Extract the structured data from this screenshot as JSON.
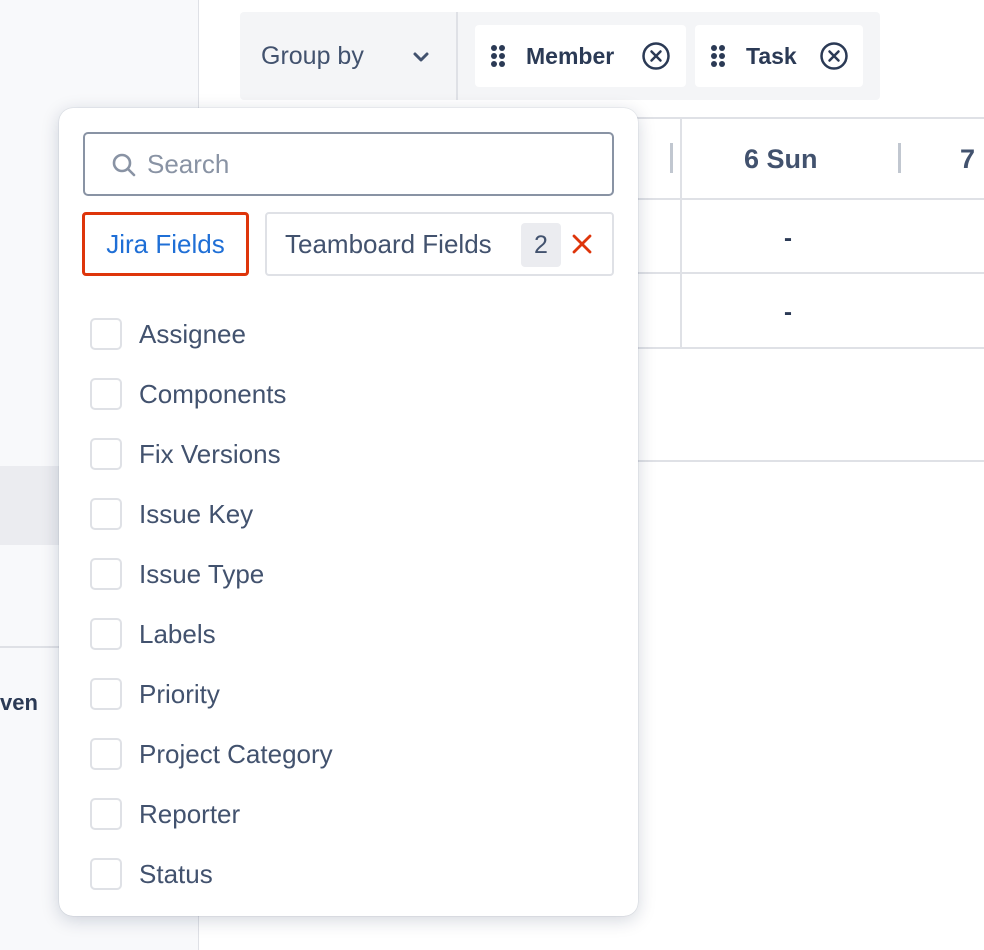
{
  "left_panel": {
    "partial_text": "ven"
  },
  "toolbar": {
    "group_by_label": "Group by",
    "chips": [
      {
        "label": "Member"
      },
      {
        "label": "Task"
      }
    ]
  },
  "calendar": {
    "days": [
      "6 Sun",
      "7"
    ],
    "cells": [
      "-",
      "-"
    ]
  },
  "dropdown": {
    "search": {
      "placeholder": "Search",
      "value": ""
    },
    "tabs": {
      "jira": {
        "label": "Jira Fields"
      },
      "teamboard": {
        "label": "Teamboard Fields",
        "count": "2"
      }
    },
    "fields": [
      {
        "label": "Assignee",
        "checked": false
      },
      {
        "label": "Components",
        "checked": false
      },
      {
        "label": "Fix Versions",
        "checked": false
      },
      {
        "label": "Issue Key",
        "checked": false
      },
      {
        "label": "Issue Type",
        "checked": false
      },
      {
        "label": "Labels",
        "checked": false
      },
      {
        "label": "Priority",
        "checked": false
      },
      {
        "label": "Project Category",
        "checked": false
      },
      {
        "label": "Reporter",
        "checked": false
      },
      {
        "label": "Status",
        "checked": false
      }
    ]
  },
  "colors": {
    "active_tab_border": "#de350b",
    "active_tab_text": "#1f6fd6",
    "clear_icon": "#de350b",
    "text": "#42526e"
  }
}
